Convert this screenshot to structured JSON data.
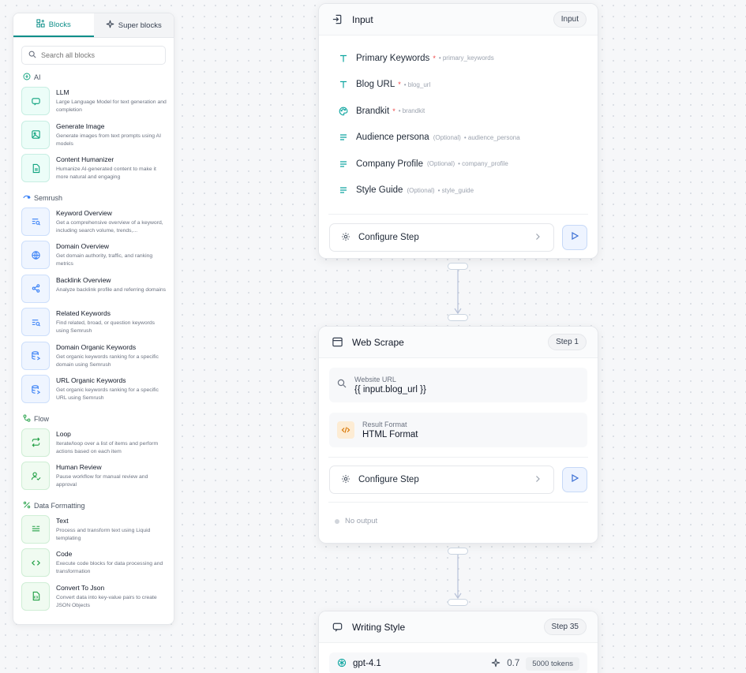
{
  "sidebar": {
    "tabs": [
      {
        "label": "Blocks"
      },
      {
        "label": "Super blocks"
      }
    ],
    "search_placeholder": "Search all blocks",
    "sections": {
      "ai": {
        "label": "AI",
        "items": [
          {
            "name": "LLM",
            "desc": "Large Language Model for text generation and completion"
          },
          {
            "name": "Generate Image",
            "desc": "Generate images from text prompts using AI models"
          },
          {
            "name": "Content Humanizer",
            "desc": "Humanize AI-generated content to make it more natural and engaging"
          }
        ]
      },
      "semrush": {
        "label": "Semrush",
        "items": [
          {
            "name": "Keyword Overview",
            "desc": "Get a comprehensive overview of a keyword, including search volume, trends,..."
          },
          {
            "name": "Domain Overview",
            "desc": "Get domain authority, traffic, and ranking metrics"
          },
          {
            "name": "Backlink Overview",
            "desc": "Analyze backlink profile and referring domains"
          },
          {
            "name": "Related Keywords",
            "desc": "Find related, broad, or question keywords using Semrush"
          },
          {
            "name": "Domain Organic Keywords",
            "desc": "Get organic keywords ranking for a specific domain using Semrush"
          },
          {
            "name": "URL Organic Keywords",
            "desc": "Get organic keywords ranking for a specific URL using Semrush"
          }
        ]
      },
      "flow": {
        "label": "Flow",
        "items": [
          {
            "name": "Loop",
            "desc": "Iterate/loop over a list of items and perform actions based on each item"
          },
          {
            "name": "Human Review",
            "desc": "Pause workflow for manual review and approval"
          }
        ]
      },
      "data_formatting": {
        "label": "Data Formatting",
        "items": [
          {
            "name": "Text",
            "desc": "Process and transform text using Liquid templating"
          },
          {
            "name": "Code",
            "desc": "Execute code blocks for data processing and transformation"
          },
          {
            "name": "Convert To Json",
            "desc": "Convert data into key-value pairs to create JSON Objects"
          }
        ]
      }
    }
  },
  "input_card": {
    "title": "Input",
    "badge": "Input",
    "fields": [
      {
        "label": "Primary Keywords",
        "required": "*",
        "optional": "",
        "key": "• primary_keywords"
      },
      {
        "label": "Blog URL",
        "required": "*",
        "optional": "",
        "key": "• blog_url"
      },
      {
        "label": "Brandkit",
        "required": "*",
        "optional": "",
        "key": "• brandkit"
      },
      {
        "label": "Audience persona",
        "required": "",
        "optional": "(Optional)",
        "key": "• audience_persona"
      },
      {
        "label": "Company Profile",
        "required": "",
        "optional": "(Optional)",
        "key": "• company_profile"
      },
      {
        "label": "Style Guide",
        "required": "",
        "optional": "(Optional)",
        "key": "• style_guide"
      }
    ],
    "configure_label": "Configure Step"
  },
  "web_scrape_card": {
    "title": "Web Scrape",
    "badge": "Step 1",
    "url_label": "Website URL",
    "url_value": "{{ input.blog_url }}",
    "format_label": "Result Format",
    "format_value": "HTML Format",
    "configure_label": "Configure Step",
    "no_output": "No output"
  },
  "writing_style_card": {
    "title": "Writing Style",
    "badge": "Step 35",
    "model": "gpt-4.1",
    "temperature": "0.7",
    "tokens": "5000 tokens"
  },
  "icons": {
    "blocks_tab": "blocks-icon",
    "super_blocks_tab": "sparkle-icon",
    "search": "search-icon",
    "configure": "gear-icon",
    "run": "play-icon"
  },
  "colors": {
    "accent": "#0f8f8a",
    "required": "#ef4444",
    "run_button": "#3b6fd4"
  }
}
